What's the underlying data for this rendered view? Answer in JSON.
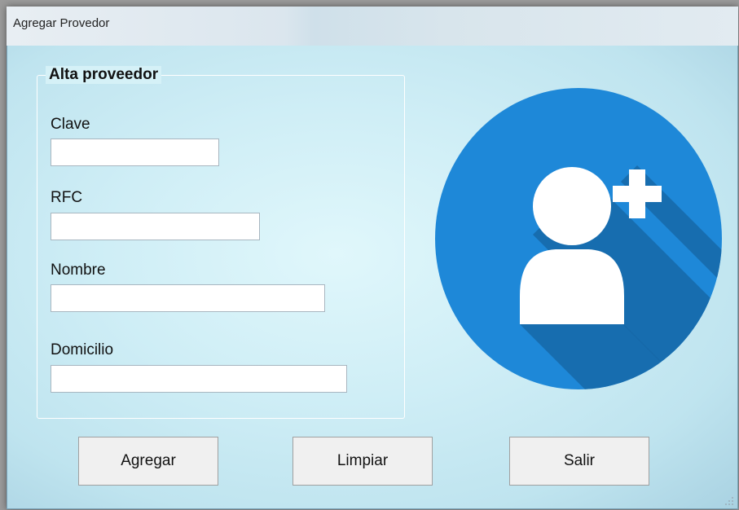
{
  "window": {
    "title": "Agregar Provedor"
  },
  "group": {
    "legend": "Alta proveedor",
    "fields": [
      {
        "label": "Clave",
        "value": ""
      },
      {
        "label": "RFC",
        "value": ""
      },
      {
        "label": "Nombre",
        "value": ""
      },
      {
        "label": "Domicilio",
        "value": ""
      }
    ]
  },
  "buttons": {
    "add": "Agregar",
    "clear": "Limpiar",
    "exit": "Salir"
  },
  "image": {
    "icon": "add-user-icon",
    "circle_color": "#1e88d8",
    "shadow_color": "#1668a8",
    "figure_color": "#ffffff"
  }
}
